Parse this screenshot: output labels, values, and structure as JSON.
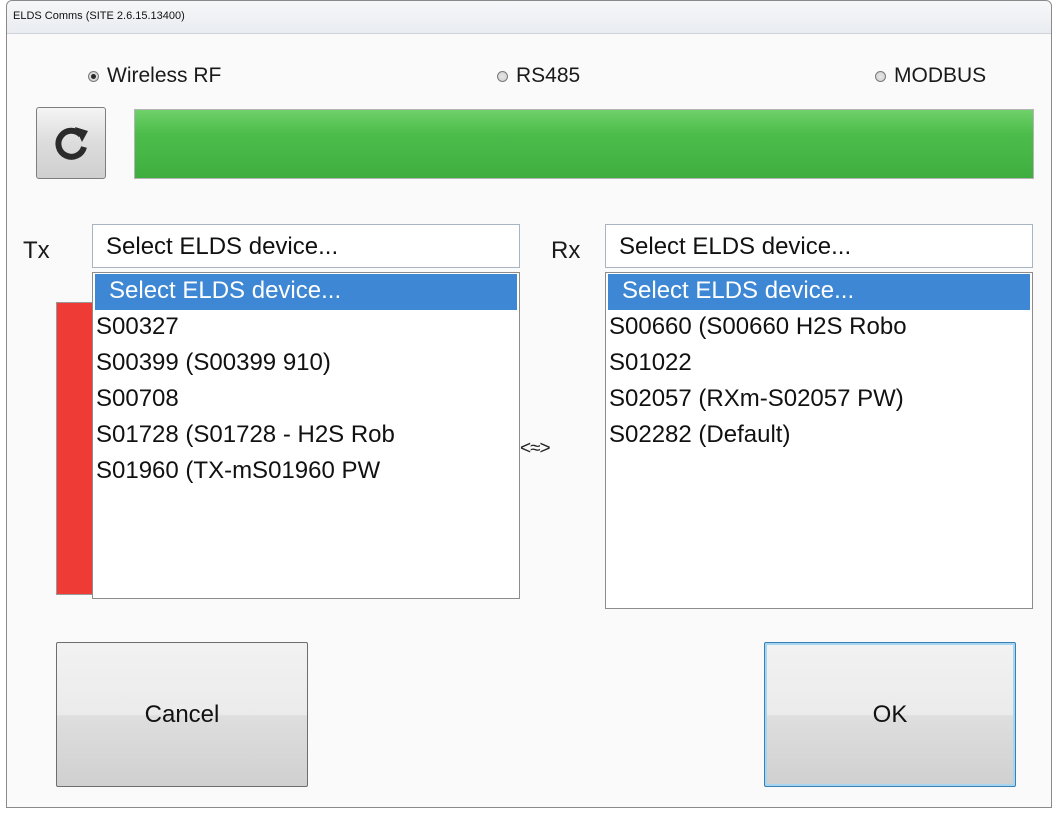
{
  "window": {
    "title": "ELDS Comms (SITE 2.6.15.13400)"
  },
  "comm_modes": [
    {
      "label": "Wireless RF",
      "checked": true
    },
    {
      "label": "RS485",
      "checked": false
    },
    {
      "label": "MODBUS",
      "checked": false
    }
  ],
  "refresh": {
    "icon": "refresh-icon"
  },
  "progress": {
    "value_percent": 100,
    "color": "#4cbd4b"
  },
  "tx": {
    "label": "Tx",
    "combo_value": "Select ELDS device...",
    "items": [
      "Select ELDS device...",
      "S00327",
      "S00399 (S00399 910)",
      "S00708",
      "S01728 (S01728 - H2S Rob",
      "S01960 (TX-mS01960 PW"
    ],
    "selected_index": 0
  },
  "rx": {
    "label": "Rx",
    "combo_value": "Select ELDS device...",
    "items": [
      "Select ELDS device...",
      "S00660 (S00660 H2S Robo",
      "S01022",
      "S02057 (RXm-S02057 PW)",
      "S02282 (Default)"
    ],
    "selected_index": 0
  },
  "link_symbol": "<≈>",
  "buttons": {
    "cancel": "Cancel",
    "ok": "OK"
  },
  "colors": {
    "status_red": "#ef3b36",
    "selection_blue": "#3d87d4"
  }
}
